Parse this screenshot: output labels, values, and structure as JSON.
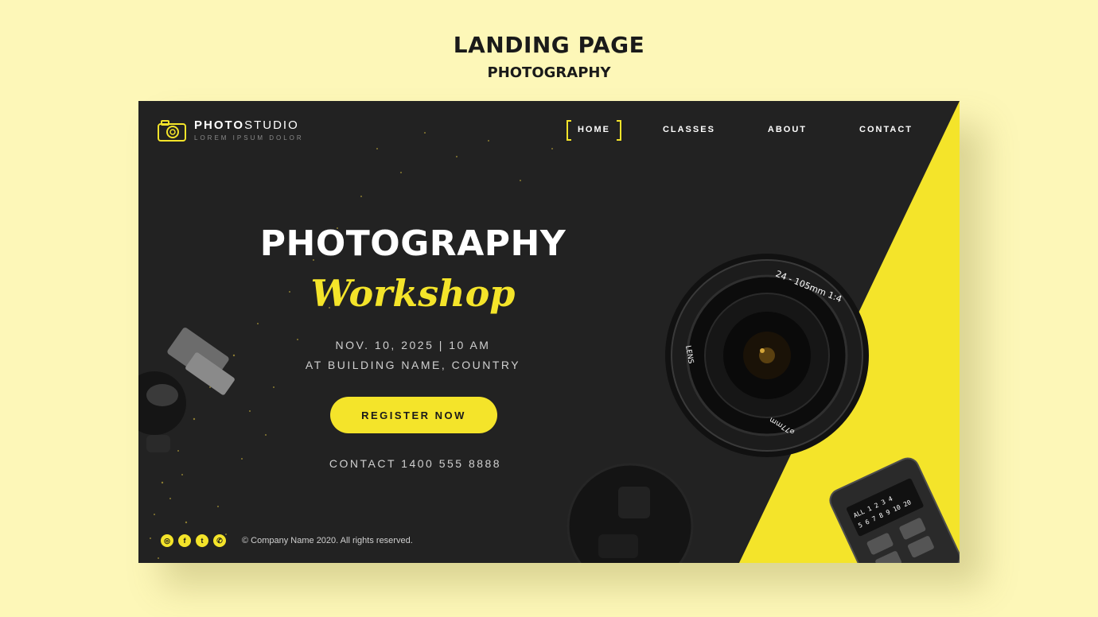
{
  "heading": {
    "title": "LANDING PAGE",
    "subtitle": "PHOTOGRAPHY"
  },
  "logo": {
    "brand_bold": "PHOTO",
    "brand_light": "STUDIO",
    "tagline": "LOREM IPSUM DOLOR",
    "icon": "camera-icon"
  },
  "nav": {
    "items": [
      "HOME",
      "CLASSES",
      "ABOUT",
      "CONTACT"
    ],
    "active": "HOME"
  },
  "hero": {
    "title": "PHOTOGRAPHY",
    "script": "Workshop",
    "date": "NOV. 10, 2025  |  10 AM",
    "place": "AT BUILDING NAME, COUNTRY",
    "cta": "REGISTER NOW",
    "contact": "CONTACT 1400 555 8888"
  },
  "lens": {
    "ring_text": "24 - 105mm  1:4",
    "side_text": "LENS",
    "filter_text": "⌀77mm"
  },
  "remote": {
    "labels": [
      "ALL",
      "1",
      "2",
      "3",
      "4",
      "5",
      "6",
      "7",
      "8",
      "9",
      "10",
      "20"
    ]
  },
  "footer": {
    "social": [
      "instagram-icon",
      "facebook-icon",
      "twitter-icon",
      "whatsapp-icon"
    ],
    "copyright": "© Company Name 2020. All rights reserved."
  },
  "colors": {
    "accent": "#f4e42a",
    "dark": "#222222",
    "background": "#fdf7b8"
  }
}
